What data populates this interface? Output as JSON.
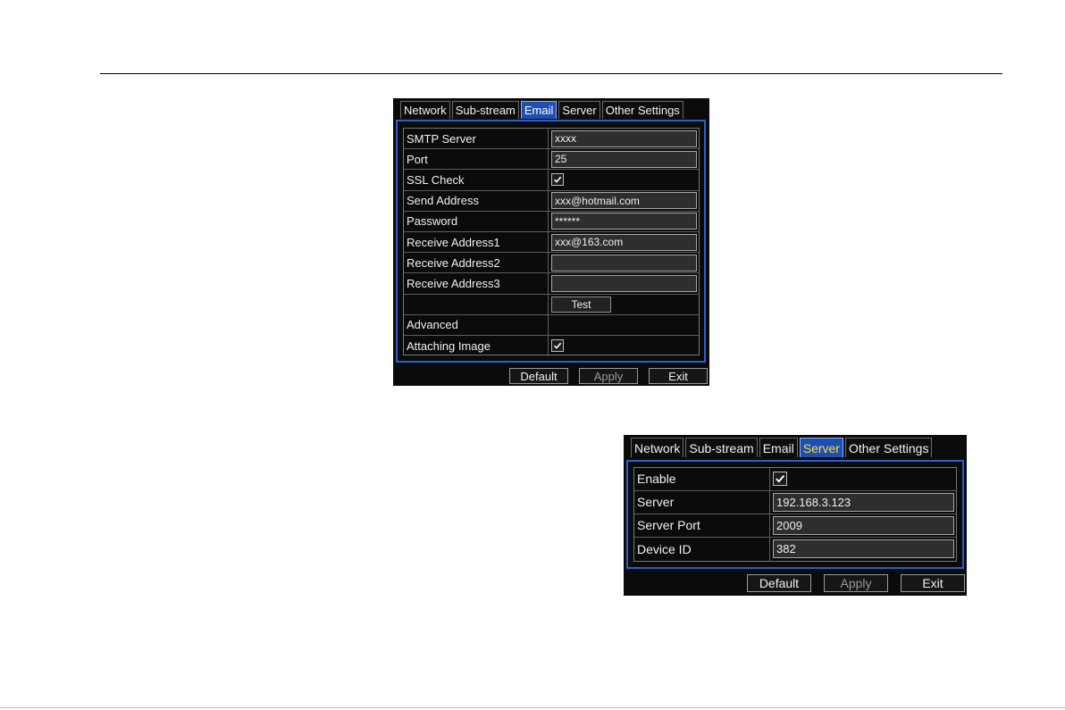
{
  "email_dialog": {
    "tabs": [
      {
        "label": "Network",
        "active": false
      },
      {
        "label": "Sub-stream",
        "active": false
      },
      {
        "label": "Email",
        "active": true
      },
      {
        "label": "Server",
        "active": false
      },
      {
        "label": "Other Settings",
        "active": false
      }
    ],
    "fields": {
      "smtp_server": {
        "label": "SMTP Server",
        "value": "xxxx"
      },
      "port": {
        "label": "Port",
        "value": "25"
      },
      "ssl_check": {
        "label": "SSL Check",
        "checked": true
      },
      "send_address": {
        "label": "Send Address",
        "value": "xxx@hotmail.com"
      },
      "password": {
        "label": "Password",
        "value": "******"
      },
      "receive_address1": {
        "label": "Receive Address1",
        "value": "xxx@163.com"
      },
      "receive_address2": {
        "label": "Receive Address2",
        "value": ""
      },
      "receive_address3": {
        "label": "Receive Address3",
        "value": ""
      },
      "test_button": "Test",
      "advanced": {
        "label": "Advanced"
      },
      "attaching_image": {
        "label": "Attaching Image",
        "checked": true
      }
    },
    "buttons": {
      "default": "Default",
      "apply": "Apply",
      "exit": "Exit"
    }
  },
  "server_dialog": {
    "tabs": [
      {
        "label": "Network",
        "active": false
      },
      {
        "label": "Sub-stream",
        "active": false
      },
      {
        "label": "Email",
        "active": false
      },
      {
        "label": "Server",
        "active": true
      },
      {
        "label": "Other Settings",
        "active": false
      }
    ],
    "fields": {
      "enable": {
        "label": "Enable",
        "checked": true
      },
      "server": {
        "label": "Server",
        "value": "192.168.3.123"
      },
      "server_port": {
        "label": "Server Port",
        "value": "2009"
      },
      "device_id": {
        "label": "Device ID",
        "value": "382"
      }
    },
    "buttons": {
      "default": "Default",
      "apply": "Apply",
      "exit": "Exit"
    }
  },
  "colors": {
    "accent_blue": "#2b5fc9",
    "active_tab": "#1e4fb0",
    "panel_bg": "#0b0b0b",
    "server_tab_text": "#f7e13a"
  }
}
